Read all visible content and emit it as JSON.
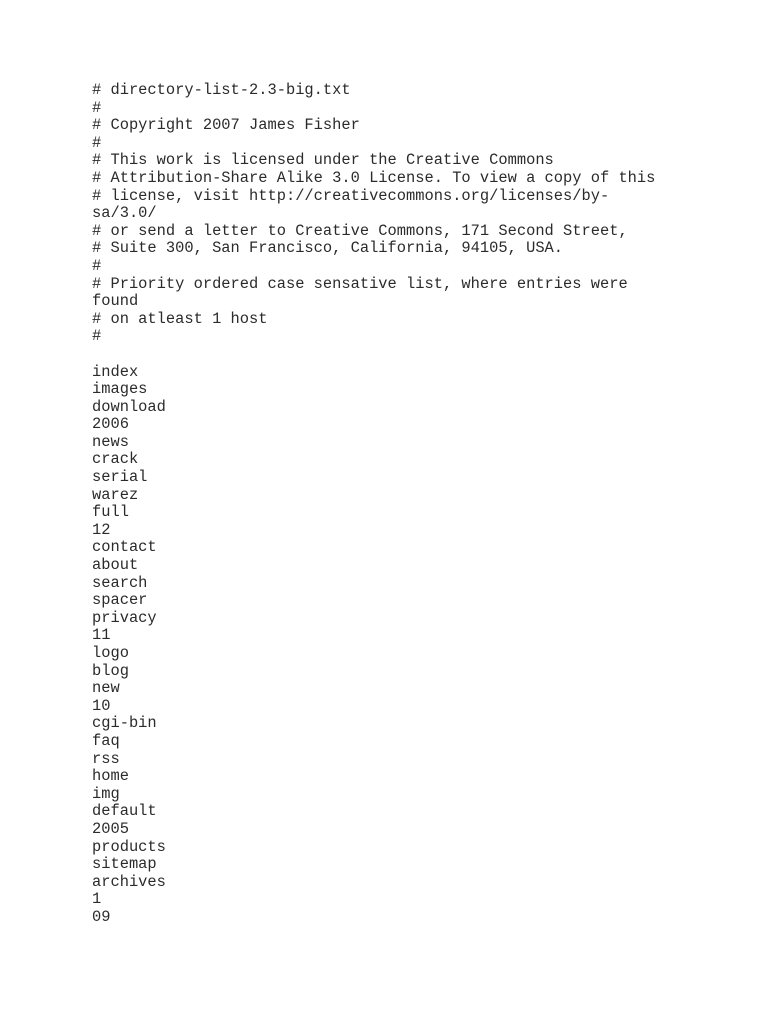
{
  "document": {
    "filename": "directory-list-2.3-big.txt",
    "background_color": "#ffffff",
    "text_color": "#2b2b2b",
    "header_lines": [
      "# directory-list-2.3-big.txt",
      "#",
      "# Copyright 2007 James Fisher",
      "#",
      "# This work is licensed under the Creative Commons",
      "# Attribution-Share Alike 3.0 License. To view a copy of this",
      "# license, visit http://creativecommons.org/licenses/by-sa/3.0/",
      "# or send a letter to Creative Commons, 171 Second Street,",
      "# Suite 300, San Francisco, California, 94105, USA.",
      "#",
      "# Priority ordered case sensative list, where entries were found",
      "# on atleast 1 host",
      "#"
    ],
    "blank_separator": "",
    "entries": [
      "index",
      "images",
      "download",
      "2006",
      "news",
      "crack",
      "serial",
      "warez",
      "full",
      "12",
      "contact",
      "about",
      "search",
      "spacer",
      "privacy",
      "11",
      "logo",
      "blog",
      "new",
      "10",
      "cgi-bin",
      "faq",
      "rss",
      "home",
      "img",
      "default",
      "2005",
      "products",
      "sitemap",
      "archives",
      "1",
      "09"
    ]
  }
}
